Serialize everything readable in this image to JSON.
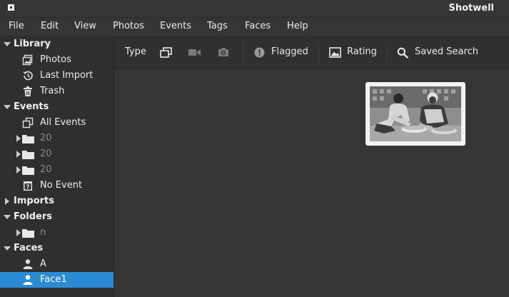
{
  "window": {
    "title": "Shotwell"
  },
  "menu": [
    "File",
    "Edit",
    "View",
    "Photos",
    "Events",
    "Tags",
    "Faces",
    "Help"
  ],
  "toolbar": {
    "type_label": "Type",
    "flagged_label": "Flagged",
    "rating_label": "Rating",
    "saved_search_label": "Saved Search"
  },
  "sidebar": {
    "library": {
      "header": "Library",
      "items": [
        "Photos",
        "Last Import",
        "Trash"
      ]
    },
    "events": {
      "header": "Events",
      "items": [
        "All Events",
        "20",
        "20",
        "20",
        "No Event"
      ]
    },
    "imports": {
      "header": "Imports"
    },
    "folders": {
      "header": "Folders",
      "items": [
        "n"
      ]
    },
    "faces": {
      "header": "Faces",
      "items": [
        "A",
        "Face1"
      ],
      "selected": "Face1"
    }
  },
  "colors": {
    "accent": "#2a8bd2",
    "background": "#353535"
  }
}
